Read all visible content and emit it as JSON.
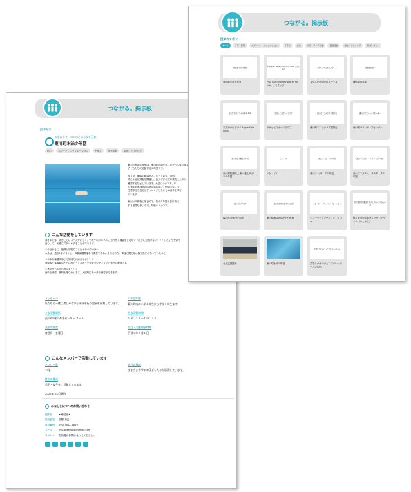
{
  "back_page": {
    "header": {
      "title": "つながる。掲示板"
    },
    "section_label": "団体紹介",
    "org": {
      "subtitle": "みなおして、ココロとカラダを元気",
      "name": "東川町水泳少年団",
      "tags": [
        "初心",
        "スポーツ・レクリエーション",
        "子育て",
        "自然活動",
        "運動・アウトドア"
      ]
    },
    "intro": [
      "東川町水泳少年団は、東川町内の小学１年から中学３年生の",
      "子どもたちで活動する少年団です。",
      "週２回、練習の練習をおこなっており、月例に",
      "式による記録会を開催し、自分がどれだけ成長したのか",
      "確認するなどしています。大会についても、年",
      "ホ毎年町水泳大会の各会場各部で、他の大会につ",
      "任意参加で自分がチャレンジしたいものは手を挙げ",
      "ています。",
      "東川川口体会となるので、他の少年団と掛け持ち",
      "する団員も多いので、特徴の１つです。"
    ],
    "activity": {
      "heading": "こんな活動をしています",
      "p1": [
        "泳ぎ手では、泳ぎごとにコース分けして、それぞれのレベルに合わせて練習をするので「泳ぎに自信がない・・・」という子供も",
        "安心して、気軽にスタートすることができます。"
      ],
      "p2": [
        "＜今日からに、指導とも取りことばかりの中の声＞",
        "水泳は、過去2年がまかし、体験講習開催中や負担で冬休よきちきの方、単独に関でない保子供ががもつていたのに"
      ],
      "p3": [
        "＜水泳の練習中などで気持ちに応えるは？？＞",
        "指導者と保護者などらにみとってスポーツ大好き少がミックで泳ぎの連続です。"
      ],
      "p4": [
        "＜途中から入るも大丈夫？？＞",
        "途中で練習、随時も練りかいます。入団時にも水泳の練習ができます。"
      ],
      "fields": [
        {
          "label": "メッセージ",
          "value": "私たちと一緒に楽しみながら水泳を行う団員を募集しています。"
        },
        {
          "label": "少年団年齢",
          "value": "東川町内の小学１年生から中学３年生まで"
        },
        {
          "label": "主な活動場所",
          "value": "東川町B＆G海洋センター プール"
        },
        {
          "label": "主な活動時間",
          "value": "１８：３０〜１９：３０"
        },
        {
          "label": "活動の頻度",
          "value": "毎週月・金曜日"
        },
        {
          "label": "設立・活動開始時期",
          "value": "平成５年５月１日"
        }
      ]
    },
    "members": {
      "heading": "こんなメンバーで活動しています",
      "fields": [
        {
          "label": "メンバー数",
          "value": "25名"
        },
        {
          "label": "年代の構成",
          "value": "さまざまな学年の子どもたちが所属しています。"
        },
        {
          "label": "性別の構成",
          "value": "男子・女子共に活動しています。"
        },
        {
          "label": "",
          "value": "2022年 10月現在"
        }
      ]
    },
    "contact": {
      "heading": "みなしとにつへのお問い合わせ",
      "rows": [
        {
          "label": "団体名",
          "value": "★東結団★"
        },
        {
          "label": "担当者名",
          "value": "佐藤 真由"
        },
        {
          "label": "電話番号",
          "value": "090-7642-1819"
        },
        {
          "label": "メール",
          "value": "hsu.kosetoho@gmail.com"
        },
        {
          "label": "コメント",
          "value": "お気軽にお問い合わせください。"
        }
      ]
    }
  },
  "front_page": {
    "header": {
      "title": "つながる。掲示板"
    },
    "category_label": "団体カテゴリー",
    "categories": [
      "すべて",
      "子育・保育",
      "スポーツ・レクリエーション",
      "子育て",
      "文化",
      "ボランティア活動",
      "自然活動",
      "運動・アウトドア",
      "料理・グルメ"
    ],
    "cards": [
      {
        "img": "朝和郡ホダモ経営",
        "cap": "菊田郡半巡を考営"
      },
      {
        "img": "Play Surf! Variety sports for kids, ふるさわぎ",
        "cap": "Play Surf! Variety sports for kids, ふるさわぎ"
      },
      {
        "img": "文学しかわのまちスクール",
        "cap": "文学しかわのゆめスクール"
      },
      {
        "img": "補給郡東事務",
        "cap": "補給郡東事務"
      },
      {
        "img": "おだかかのクライ Apple Kids",
        "cap": "おだかかのクライ Apple Kids Cock!"
      },
      {
        "img": "かがっとスポーツクラブ",
        "cap": "かがっとスポーツクラブ"
      },
      {
        "img": "東川町ミニテクラブ愛好会",
        "cap": "東川町ミニテクラブ愛好会"
      },
      {
        "img": "東川町ボランティアセンター",
        "cap": "東川町ボランティアセンター"
      },
      {
        "img": "東川町陸上競技少年団",
        "cap": "東川町陸源陸上 東川陸上スポーツ少年団"
      },
      {
        "img": "ジム・ゲ5",
        "cap": "ジム・ゲ5"
      },
      {
        "img": "東川ティ/ローデ少年団",
        "cap": "東川ティ/ローデ少年団"
      },
      {
        "img": "東川フリスタレーネスターズ少年団",
        "cap": "東川フリスタレーネスターズ少年団"
      },
      {
        "img": "森川水泳少年団",
        "cap": "森川水泳東団少年団"
      },
      {
        "img": "東川絵画同好会子ども教室",
        "cap": "東川絵画同好会子ども教室"
      },
      {
        "img": "ソニーカー・アンドマンブロ・イコイ",
        "cap": "リコーダーアンサンブル・イコイ"
      },
      {
        "img": "特定非営利活動法人ひがしかわくつ(みんみん)",
        "cap": "特定非営利活動法人ひがしかわくつ（みんみん）"
      },
      {
        "img": "",
        "cap": "北北支援団を",
        "photo": "team"
      },
      {
        "img": "",
        "cap": "東川町水泳少年団",
        "photo": "pool"
      },
      {
        "img": "文学しかわのジュニアバレーボール",
        "cap": "文学しかわのジュニアバレーボール少年団"
      }
    ]
  }
}
